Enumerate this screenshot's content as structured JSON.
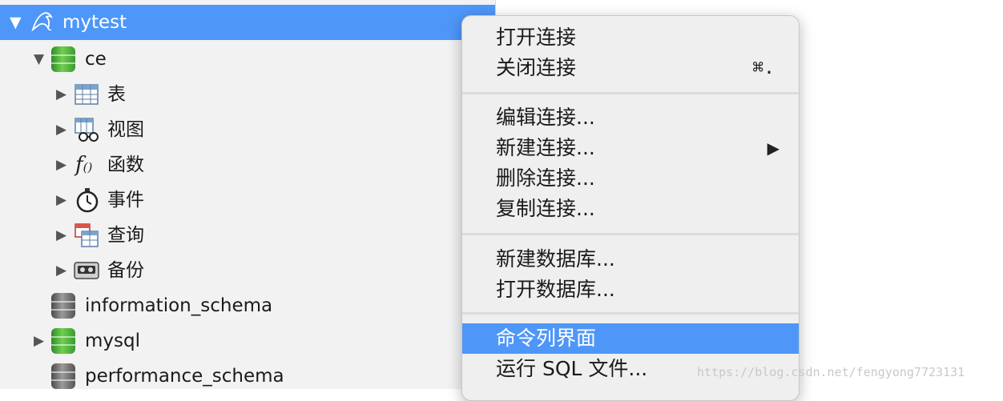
{
  "sidebar": {
    "connection": {
      "label": "mytest"
    },
    "databases": [
      {
        "label": "ce"
      },
      {
        "label": "information_schema"
      },
      {
        "label": "mysql"
      },
      {
        "label": "performance_schema"
      }
    ],
    "ce_children": [
      {
        "label": "表",
        "icon": "table-icon"
      },
      {
        "label": "视图",
        "icon": "view-icon"
      },
      {
        "label": "函数",
        "icon": "function-icon"
      },
      {
        "label": "事件",
        "icon": "stopwatch-icon"
      },
      {
        "label": "查询",
        "icon": "query-icon"
      },
      {
        "label": "备份",
        "icon": "backup-icon"
      }
    ]
  },
  "context_menu": {
    "items": [
      {
        "label": "打开连接"
      },
      {
        "label": "关闭连接",
        "shortcut": "⌘."
      },
      {
        "label": "编辑连接..."
      },
      {
        "label": "新建连接...",
        "submenu_arrow": "▶"
      },
      {
        "label": "删除连接..."
      },
      {
        "label": "复制连接..."
      },
      {
        "label": "新建数据库..."
      },
      {
        "label": "打开数据库..."
      },
      {
        "label": "命令列界面"
      },
      {
        "label": "运行 SQL 文件..."
      }
    ]
  },
  "watermark": "https://blog.csdn.net/fengyong7723131",
  "colors": {
    "selection": "#4e97f9",
    "sidebar_bg": "#f2f2f2",
    "menu_bg": "#efefef",
    "db_green": "#3fae35"
  }
}
